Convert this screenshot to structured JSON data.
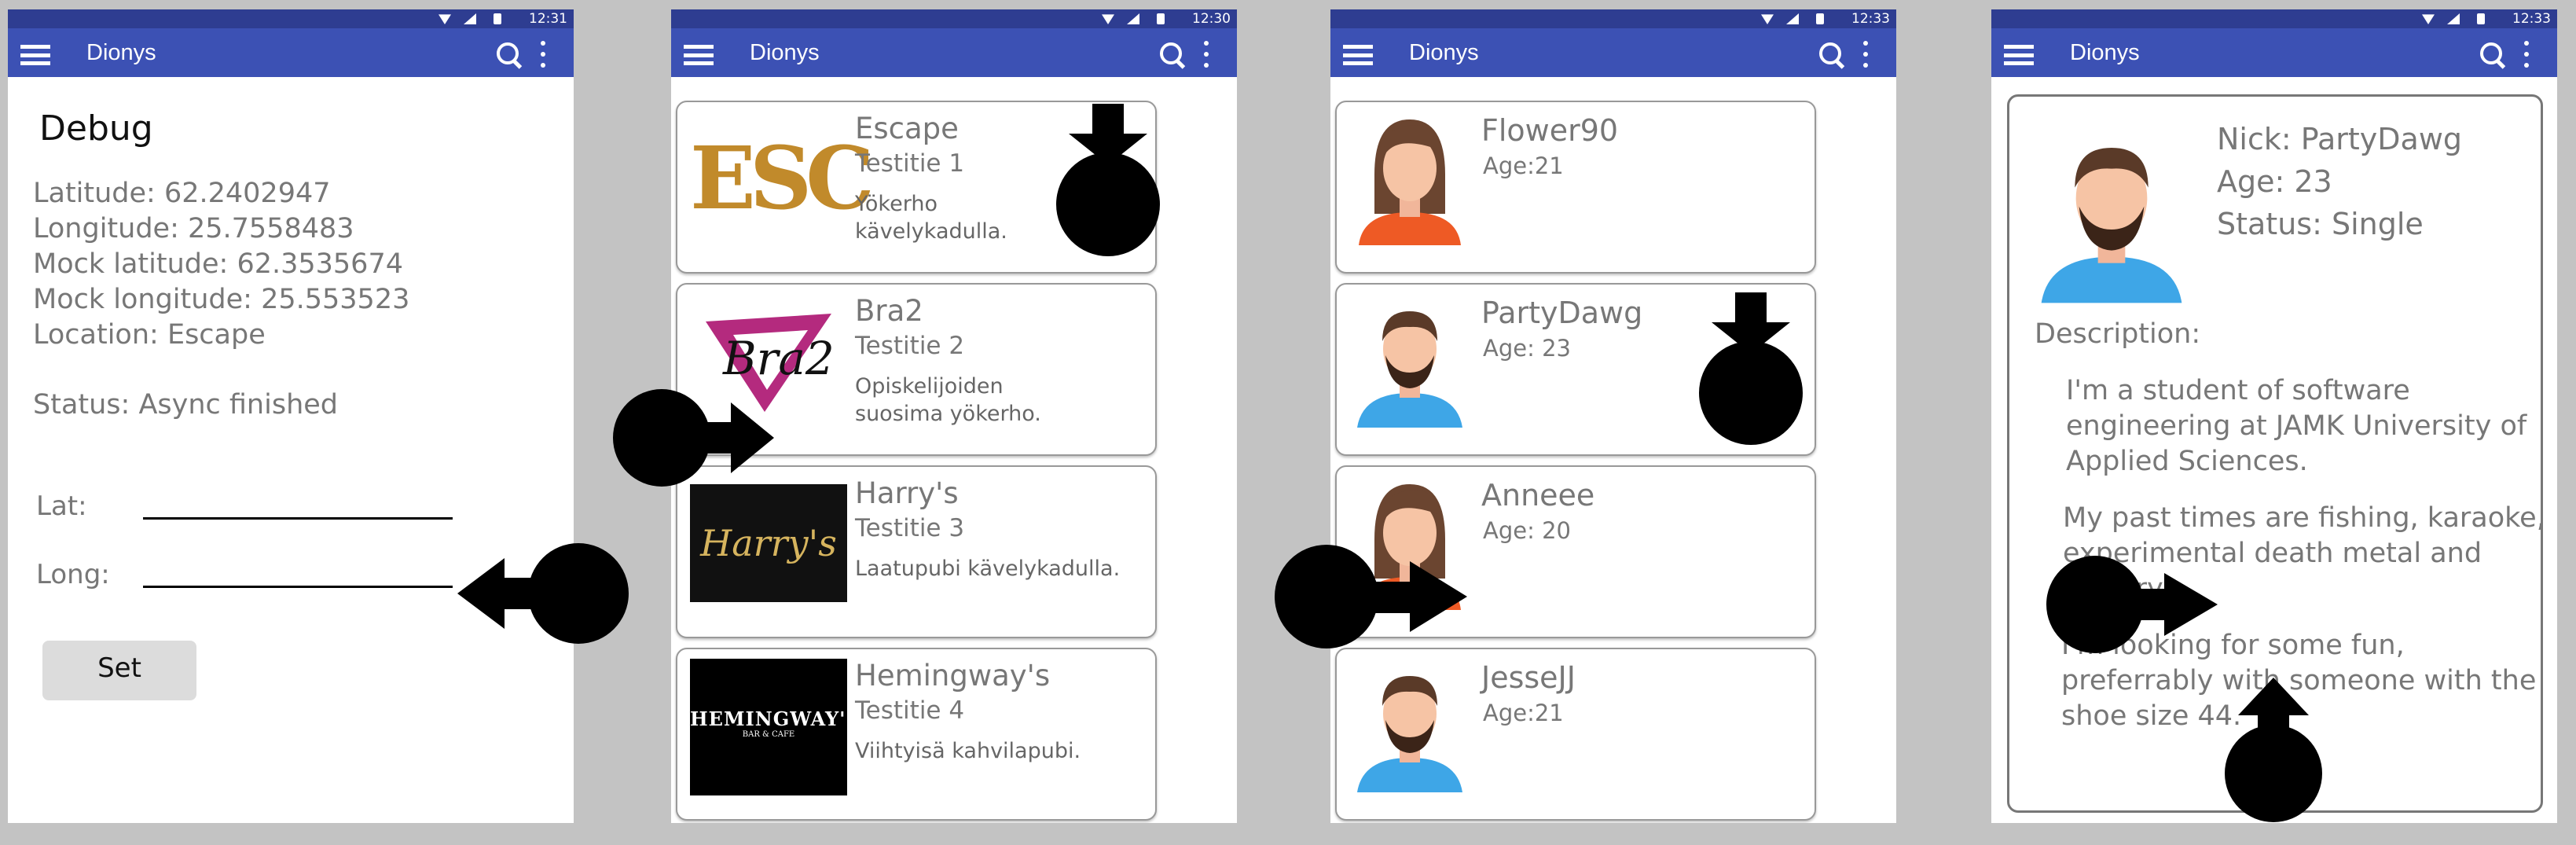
{
  "app_title": "Dionys",
  "screens": [
    {
      "time": "12:31",
      "debug": {
        "title": "Debug",
        "lines": [
          "Latitude: 62.2402947",
          "Longitude: 25.7558483",
          "Mock latitude: 62.3535674",
          "Mock longitude: 25.553523",
          "Location: Escape"
        ],
        "status": "Status: Async finished",
        "lat_label": "Lat:",
        "long_label": "Long:",
        "set_label": "Set"
      }
    },
    {
      "time": "12:30",
      "venues": [
        {
          "name": "Escape",
          "address": "Testitie 1",
          "description": "Yökerho\nkävelykadulla.",
          "logo_text": "ESC"
        },
        {
          "name": "Bra2",
          "address": "Testitie 2",
          "description": "Opiskelijoiden\nsuosima yökerho.",
          "logo_text": "Bra2"
        },
        {
          "name": "Harry's",
          "address": "Testitie 3",
          "description": "Laatupubi kävelykadulla.",
          "logo_text": "Harry's"
        },
        {
          "name": "Hemingway's",
          "address": "Testitie 4",
          "description": "Viihtyisä kahvilapubi.",
          "logo_text": "HEMINGWAY'S",
          "logo_subtext": "BAR & CAFE"
        }
      ]
    },
    {
      "time": "12:33",
      "users": [
        {
          "name": "Flower90",
          "age": "Age:21",
          "avatar": "female-avatar-orange"
        },
        {
          "name": "PartyDawg",
          "age": "Age: 23",
          "avatar": "male-avatar-blue"
        },
        {
          "name": "Anneee",
          "age": "Age: 20",
          "avatar": "female-avatar-orange"
        },
        {
          "name": "JesseJJ",
          "age": "Age:21",
          "avatar": "male-avatar-blue"
        }
      ]
    },
    {
      "time": "12:33",
      "profile": {
        "nick": "Nick: PartyDawg",
        "age": "Age: 23",
        "status": "Status: Single",
        "description_label": "Description:",
        "paragraphs": [
          "I'm a student of software engineering at JAMK University of Applied Sciences.",
          "My past times are fishing, karaoke, experimental death metal and pottery.",
          "I'm looking for some fun, preferrably with someone with the shoe size 44."
        ]
      }
    }
  ],
  "colors": {
    "appbar": "#3c51b4",
    "statusbar": "#2e3d91",
    "background": "#c3c3c3"
  }
}
